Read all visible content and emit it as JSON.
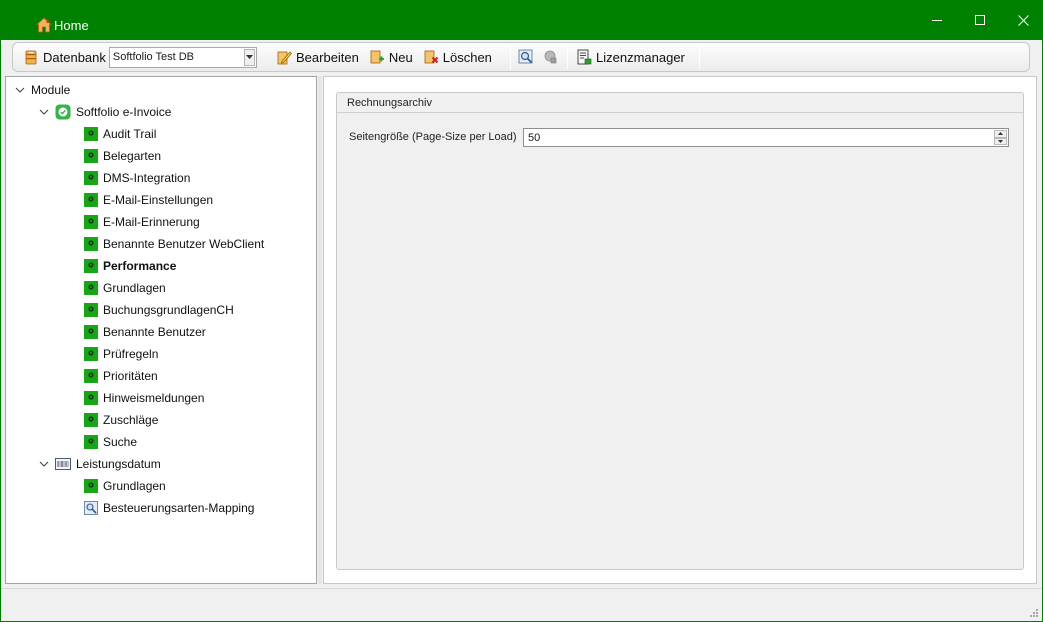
{
  "window": {
    "title": "Home",
    "controls": {
      "minimize": "minimize-icon",
      "maximize": "maximize-icon",
      "close": "close-icon"
    },
    "accent_color": "#008000"
  },
  "toolbar": {
    "database_label": "Datenbank",
    "database_value": "Softfolio Test DB",
    "edit_label": "Bearbeiten",
    "new_label": "Neu",
    "delete_label": "Löschen",
    "license_label": "Lizenzmanager"
  },
  "tree": {
    "root": "Module",
    "group1": {
      "label": "Softfolio e-Invoice",
      "items": [
        "Audit Trail",
        "Belegarten",
        "DMS-Integration",
        "E-Mail-Einstellungen",
        "E-Mail-Erinnerung",
        "Benannte Benutzer WebClient",
        "Performance",
        "Grundlagen",
        "BuchungsgrundlagenCH",
        "Benannte Benutzer",
        "Prüfregeln",
        "Prioritäten",
        "Hinweismeldungen",
        "Zuschläge",
        "Suche"
      ],
      "selected": "Performance"
    },
    "group2": {
      "label": "Leistungsdatum",
      "items": [
        "Grundlagen",
        "Besteuerungsarten-Mapping"
      ]
    }
  },
  "content": {
    "group_title": "Rechnungsarchiv",
    "field_label": "Seitengröße (Page-Size per Load)",
    "field_value": "50"
  }
}
